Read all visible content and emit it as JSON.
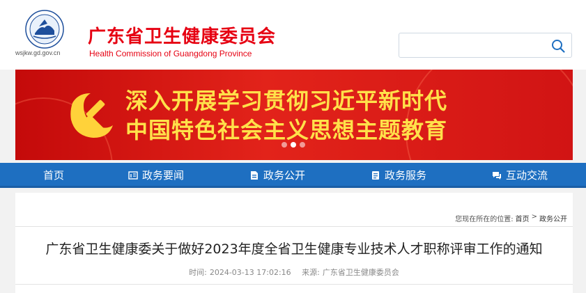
{
  "header": {
    "domain": "wsjkw.gd.gov.cn",
    "title_cn": "广东省卫生健康委员会",
    "title_en": "Health Commission of Guangdong Province",
    "logo_icon": "gd-health-emblem-icon"
  },
  "search": {
    "placeholder": "",
    "icon": "search-icon",
    "accent": "#1e6fc1"
  },
  "banner": {
    "line1": "深入开展学习贯彻习近平新时代",
    "line2": "中国特色社会主义思想主题教育",
    "slides_total": 3,
    "active_slide": 2,
    "emblem_icon": "hammer-sickle-icon",
    "bg_color": "#d11414",
    "text_color": "#ffe14a"
  },
  "nav": {
    "items": [
      {
        "label": "首页",
        "icon": ""
      },
      {
        "label": "政务要闻",
        "icon": "news-icon"
      },
      {
        "label": "政务公开",
        "icon": "document-icon"
      },
      {
        "label": "政务服务",
        "icon": "service-icon"
      },
      {
        "label": "互动交流",
        "icon": "chat-icon"
      }
    ],
    "bg_color": "#1e6fc1"
  },
  "breadcrumb": {
    "prefix": "您现在所在的位置:",
    "items": [
      "首页",
      "政务公开"
    ],
    "separator": ">"
  },
  "article": {
    "title": "广东省卫生健康委关于做好2023年度全省卫生健康专业技术人才职称评审工作的通知",
    "time_label": "时间:",
    "time": "2024-03-13 17:02:16",
    "source_label": "来源:",
    "source": "广东省卫生健康委员会"
  }
}
